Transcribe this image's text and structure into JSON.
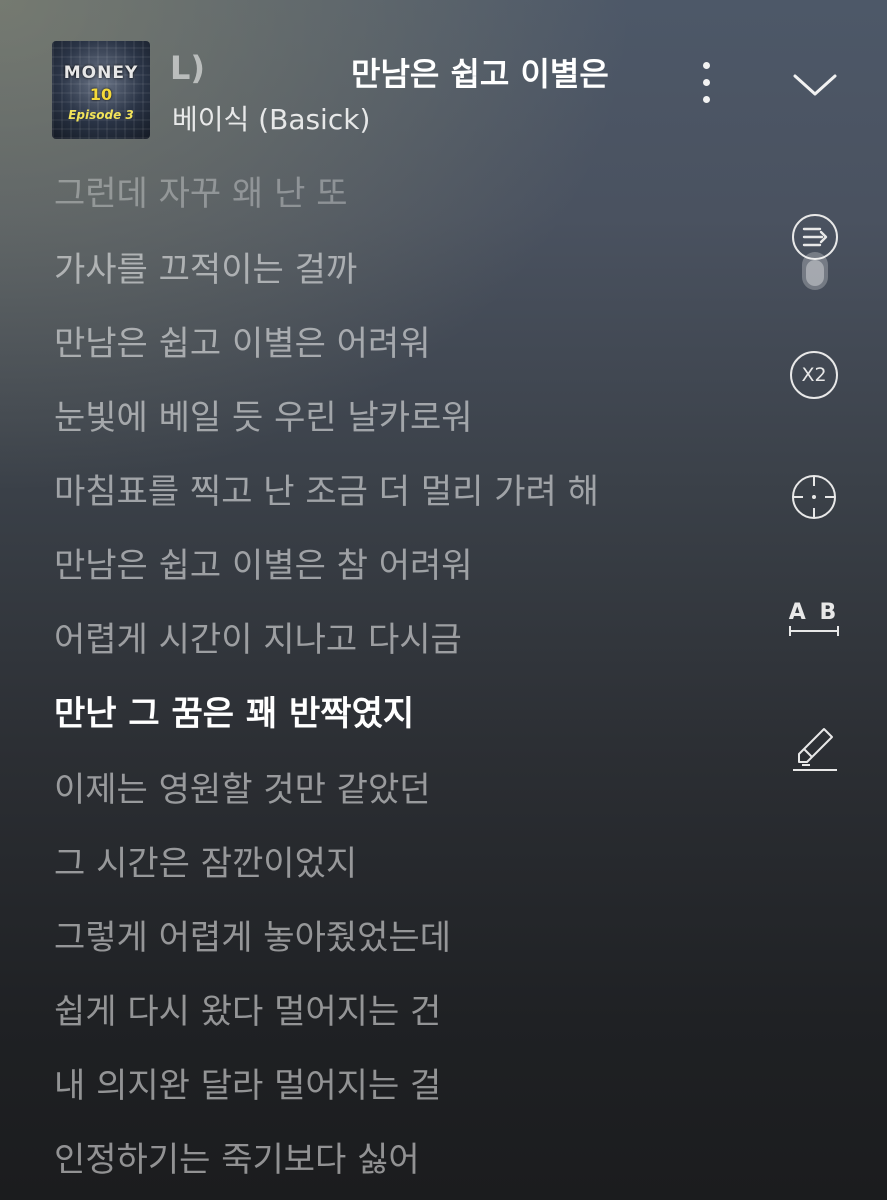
{
  "header": {
    "album_text_main": "MONEY",
    "album_text_number": "10",
    "album_episode": "Episode 3",
    "title_prefix": "L)",
    "title": "만남은 쉽고 이별은",
    "artist": "베이식 (Basick)"
  },
  "lyrics": [
    "그런데 자꾸 왜 난 또",
    "가사를 끄적이는 걸까",
    "만남은 쉽고 이별은 어려워",
    "눈빛에 베일 듯 우린 날카로워",
    "마침표를 찍고 난 조금 더 멀리 가려 해",
    "만남은 쉽고 이별은 참 어려워",
    "어렵게 시간이 지나고 다시금",
    "만난 그 꿈은 꽤 반짝였지",
    "이제는 영원할 것만 같았던",
    "그 시간은 잠깐이었지",
    "그렇게 어렵게 놓아줬었는데",
    "쉽게 다시 왔다 멀어지는 건",
    "내 의지완 달라 멀어지는 걸",
    "인정하기는 죽기보다 싫어"
  ],
  "current_line_index": 7,
  "controls": {
    "speed_label": "X2",
    "translate_label": "A B"
  },
  "colors": {
    "current_lyric": "#ffffff",
    "inactive_lyric": "rgba(255,255,255,0.52)"
  }
}
